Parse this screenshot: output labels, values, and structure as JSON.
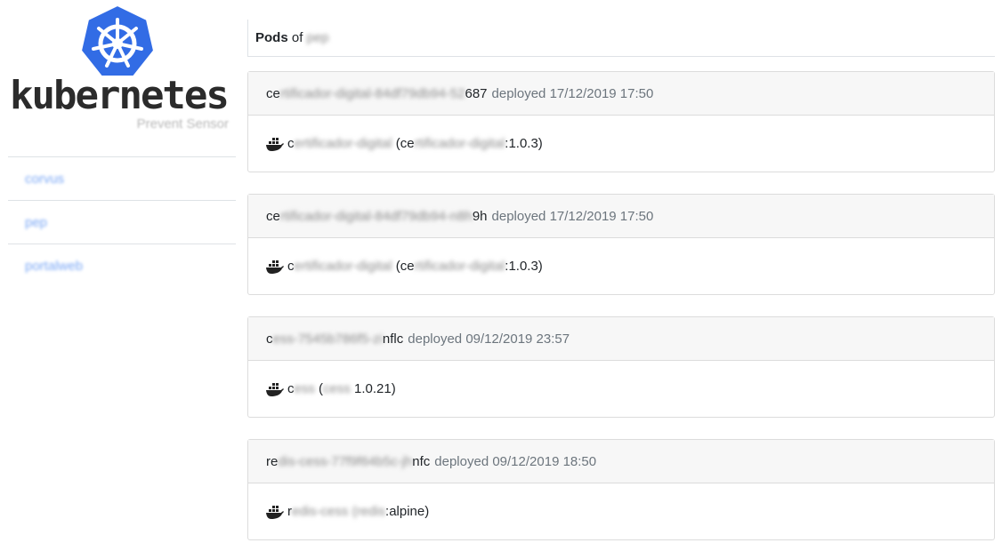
{
  "sidebar": {
    "brand": "kubernetes",
    "subtitle": "Prevent Sensor",
    "items": [
      {
        "label": "corvus"
      },
      {
        "label": "pep"
      },
      {
        "label": "portalweb"
      }
    ]
  },
  "main": {
    "header": {
      "prefix": "Pods",
      "of": "of",
      "namespace": "pep"
    },
    "pods": [
      {
        "name_start": "ce",
        "name_hidden": "rtificador-digital-84df79db94-52",
        "name_end": "687",
        "deployed": "deployed 17/12/2019 17:50",
        "container": {
          "name_start": "c",
          "name_hidden": "ertificador-digital",
          "open": " (ce",
          "image_hidden": "rtificador-digital",
          "tag": ":1.0.3)"
        }
      },
      {
        "name_start": "ce",
        "name_hidden": "rtificador-digital-84df79db94-n8h",
        "name_end": "9h",
        "deployed": "deployed 17/12/2019 17:50",
        "container": {
          "name_start": "c",
          "name_hidden": "ertificador-digital",
          "open": " (ce",
          "image_hidden": "rtificador-digital",
          "tag": ":1.0.3)"
        }
      },
      {
        "name_start": "c",
        "name_hidden": "ess-7545b786f5-zi",
        "name_end": "nflc",
        "deployed": "deployed 09/12/2019 23:57",
        "container": {
          "name_start": "c",
          "name_hidden": "ess",
          "open": " (",
          "image_hidden": "cess",
          "tag": " 1.0.21)"
        }
      },
      {
        "name_start": "re",
        "name_hidden": "dis-cess-77f9f64b5c-jh",
        "name_end": "nfc",
        "deployed": "deployed 09/12/2019 18:50",
        "container": {
          "name_start": "r",
          "name_hidden": "edis-cess (redis",
          "open": "",
          "image_hidden": "",
          "tag": ":alpine)"
        }
      }
    ]
  },
  "colors": {
    "logo_blue": "#326ce5",
    "link": "#7aa7f5"
  },
  "icons": {
    "logo": "kubernetes-helm-icon",
    "container": "docker-whale-icon"
  }
}
